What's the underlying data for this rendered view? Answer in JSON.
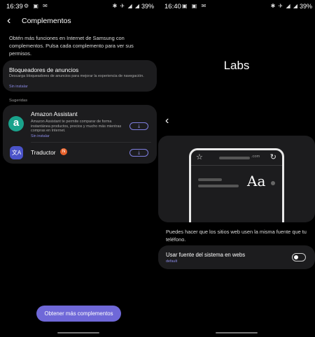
{
  "left_screen": {
    "status": {
      "time": "16:39",
      "notif_icons": "⚙ ▣ ✉",
      "sys_icons": "✱ ✈ ◢ ◢",
      "battery": "39%"
    },
    "header": {
      "title": "Complementos"
    },
    "intro": "Obtén más funciones en Internet de Samsung con complementos. Pulsa cada complemento para ver sus permisos.",
    "blockers": {
      "title": "Bloqueadores de anuncios",
      "description": "Descarga bloqueadores de anuncios para mejorar la experiencia de navegación.",
      "status": "Sin instalar"
    },
    "section_label": "Sugeridas",
    "suggested": [
      {
        "icon_letter": "a",
        "name": "Amazon Assistant",
        "description": "Amazon Assistant te permite comparar de forma instantánea productos, precios y mucho más mientras compras en Internet.",
        "status": "Sin instalar"
      },
      {
        "icon_letter": "文A",
        "name": "Traductor",
        "badge": "N"
      }
    ],
    "download_glyph": "⤓",
    "more_button": "Obtener más complementos"
  },
  "right_screen": {
    "status": {
      "time": "16:40",
      "notif_icons": "▣ ▣ ✉",
      "sys_icons": "✱ ✈ ◢ ◢",
      "battery": "39%"
    },
    "title": "Labs",
    "preview": {
      "domain_suffix": ".com",
      "sample_text": "Aa"
    },
    "description": "Puedes hacer que los sitios web usen la misma fuente que tu teléfono.",
    "setting": {
      "label": "Usar fuente del sistema en webs",
      "value": "default",
      "enabled": false
    }
  },
  "colors": {
    "accent": "#6f68d8",
    "link": "#8a8ae6",
    "card": "#1c1c1e",
    "amazon": "#1aa38c",
    "new_badge": "#e8622c"
  }
}
